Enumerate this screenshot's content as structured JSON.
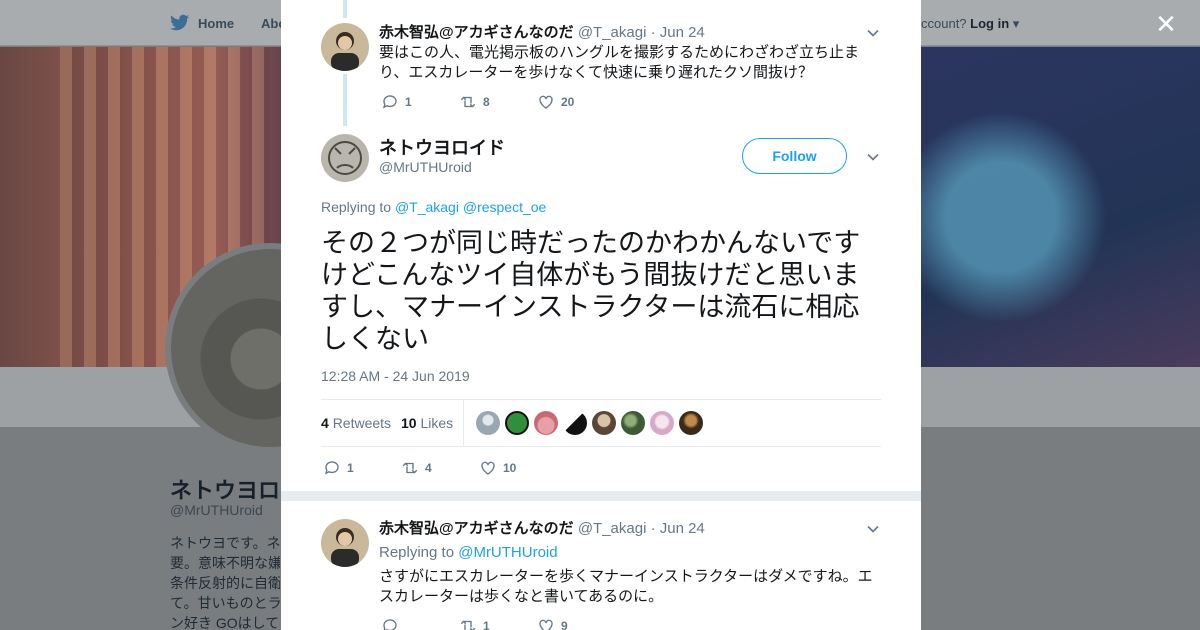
{
  "nav": {
    "home_label": "Home",
    "about_label": "Abo",
    "login_prefix": "ccount?",
    "login_label": "Log in"
  },
  "profile": {
    "name": "ネトウヨロ",
    "handle": "@MrUTHUroid",
    "bio_lines": [
      "ネトウヨです。ネ",
      "要。意味不明な嫌",
      "条件反射的に自衛",
      "て。甘いものとラ",
      "ン好き GOはして"
    ]
  },
  "thread": {
    "tweets": [
      {
        "name": "赤木智弘@アカギさんなのだ",
        "handle": "@T_akagi",
        "date": "· Jun 24",
        "text": "要はこの人、電光掲示板のハングルを撮影するためにわざわざ立ち止まり、エスカレーターを歩けなくて快速に乗り遅れたクソ間抜け？",
        "replies": "1",
        "retweets": "8",
        "likes": "20"
      }
    ]
  },
  "main_tweet": {
    "name": "ネトウヨロイド",
    "handle": "@MrUTHUroid",
    "follow_label": "Follow",
    "replying_prefix": "Replying to",
    "replying_to": [
      "@T_akagi",
      "@respect_oe"
    ],
    "text": "その２つが同じ時だったのかわかんないですけどこんなツイ自体がもう間抜けだと思いますし、マナーインストラクターは流石に相応しくない",
    "timestamp": "12:28 AM - 24 Jun 2019",
    "retweets_count": "4",
    "retweets_label": "Retweets",
    "likes_count": "10",
    "likes_label": "Likes",
    "replies": "1",
    "retweets": "4",
    "likes": "10"
  },
  "replies": [
    {
      "name": "赤木智弘@アカギさんなのだ",
      "handle": "@T_akagi",
      "date": "· Jun 24",
      "replying_prefix": "Replying to",
      "replying_to": "@MrUTHUroid",
      "text": "さすがにエスカレーターを歩くマナーインストラクターはダメですね。エスカレーターは歩くなと書いてあるのに。",
      "replies": "",
      "retweets": "1",
      "likes": "9"
    }
  ],
  "colors": {
    "link": "#1da1f2",
    "muted": "#657786",
    "divider": "#e6ecf0"
  },
  "icons": {
    "close": "close-icon",
    "reply": "reply-icon",
    "retweet": "retweet-icon",
    "like": "heart-icon"
  }
}
